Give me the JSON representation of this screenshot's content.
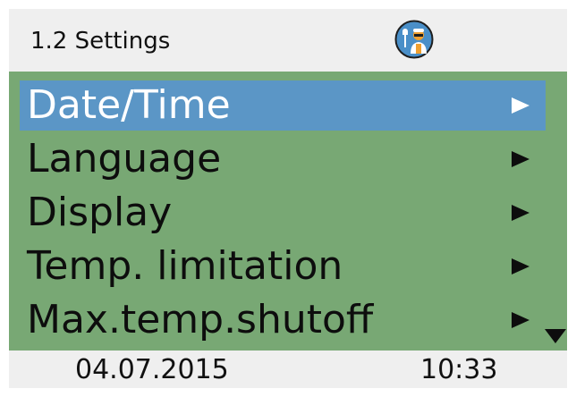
{
  "header": {
    "title": "1.2 Settings",
    "icon": "service-technician-icon"
  },
  "menu": {
    "items": [
      {
        "label": "Date/Time",
        "selected": true,
        "icon": "arrow-right-icon"
      },
      {
        "label": "Language",
        "selected": false,
        "icon": "arrow-right-icon"
      },
      {
        "label": "Display",
        "selected": false,
        "icon": "arrow-right-icon"
      },
      {
        "label": "Temp. limitation",
        "selected": false,
        "icon": "arrow-right-icon"
      },
      {
        "label": "Max.temp.shutoff",
        "selected": false,
        "icon": "arrow-right-icon"
      }
    ],
    "more_below_icon": "arrow-down-icon"
  },
  "footer": {
    "date": "04.07.2015",
    "time": "10:33"
  },
  "colors": {
    "background": "#efefef",
    "menu_background": "#78a874",
    "selection": "#5b96c6",
    "text": "#111111",
    "icon_background": "#4a8fc8",
    "icon_accent": "#f0a030"
  }
}
